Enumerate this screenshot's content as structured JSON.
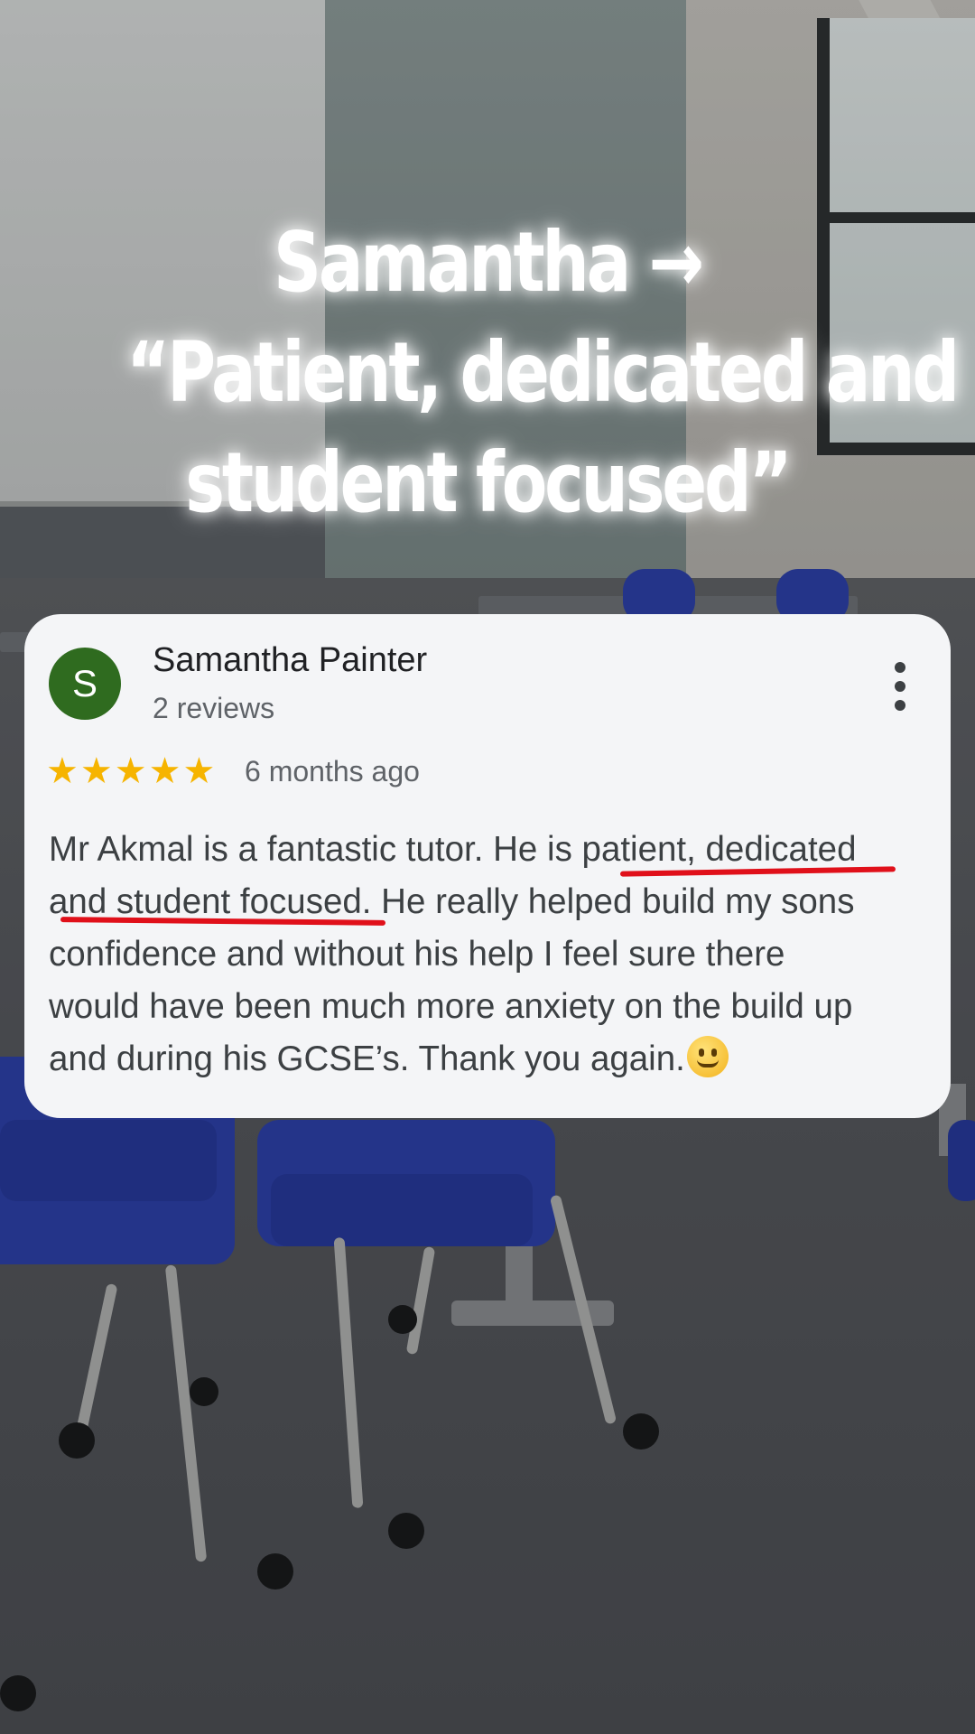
{
  "headline": {
    "line1": "Samantha →",
    "line2": "“Patient, dedicated and",
    "line3": "student focused”"
  },
  "review": {
    "avatar_letter": "S",
    "avatar_color": "#2f6b1f",
    "reviewer_name": "Samantha Painter",
    "review_count": "2 reviews",
    "rating": 5,
    "rating_max": 5,
    "star_color": "#f6b400",
    "time_ago": "6 months ago",
    "more_icon": "vertical-ellipsis-icon",
    "text": {
      "line1_a": "Mr Akmal is a fantastic tutor. He is ",
      "line1_highlight": "patient, dedicated",
      "line2_highlight": "and student focused",
      "line2_b": ". He really helped build my sons",
      "line3": "confidence and without his help I feel sure there",
      "line4": "would have been much more anxiety on the build up",
      "line5": "and during his GCSE’s. Thank you again."
    },
    "emoji": "slightly-smiling-face-icon",
    "underline_color": "#e0101a"
  }
}
